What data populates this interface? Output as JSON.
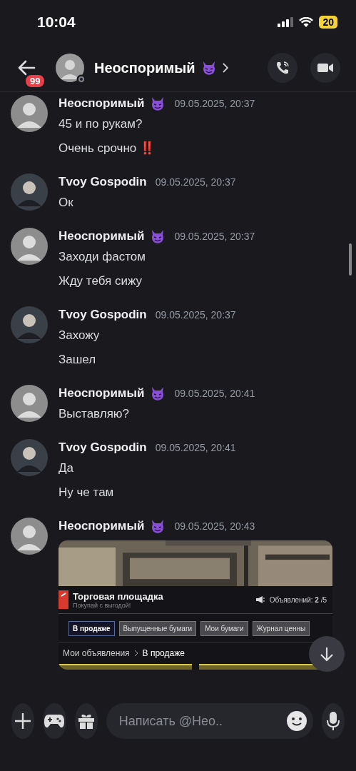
{
  "status_bar": {
    "time": "10:04",
    "battery": "20"
  },
  "header": {
    "unread_badge": "99",
    "title": "Неоспоримый",
    "emoji_badge": true
  },
  "messages": [
    {
      "author": "Неоспоримый",
      "emoji_badge": true,
      "time": "09.05.2025, 20:37",
      "lines": [
        "45 и по рукам?",
        "Очень срочно ‼️"
      ]
    },
    {
      "author": "Tvoy Gospodin",
      "emoji_badge": false,
      "time": "09.05.2025, 20:37",
      "lines": [
        "Ок"
      ]
    },
    {
      "author": "Неоспоримый",
      "emoji_badge": true,
      "time": "09.05.2025, 20:37",
      "lines": [
        "Заходи фастом",
        "Жду тебя сижу"
      ]
    },
    {
      "author": "Tvoy Gospodin",
      "emoji_badge": false,
      "time": "09.05.2025, 20:37",
      "lines": [
        "Захожу",
        "Зашел"
      ]
    },
    {
      "author": "Неоспоримый",
      "emoji_badge": true,
      "time": "09.05.2025, 20:41",
      "lines": [
        "Выставляю?"
      ]
    },
    {
      "author": "Tvoy Gospodin",
      "emoji_badge": false,
      "time": "09.05.2025, 20:41",
      "lines": [
        "Да",
        "Ну че там"
      ]
    },
    {
      "author": "Неоспоримый",
      "emoji_badge": true,
      "time": "09.05.2025, 20:43",
      "attachment": {
        "title": "Торговая площадка",
        "subtitle": "Покупай с выгодой!",
        "counter": "Объявлений: **2** /5",
        "tabs": [
          {
            "label": "В продаже",
            "selected": true
          },
          {
            "label": "Выпущенные бумаги",
            "selected": false
          },
          {
            "label": "Мои бумаги",
            "selected": false
          },
          {
            "label": "Журнал ценны",
            "selected": false
          }
        ],
        "breadcrumb": [
          "Мои объявления",
          "В продаже"
        ]
      }
    }
  ],
  "composer": {
    "placeholder": "Написать @Нео.."
  }
}
